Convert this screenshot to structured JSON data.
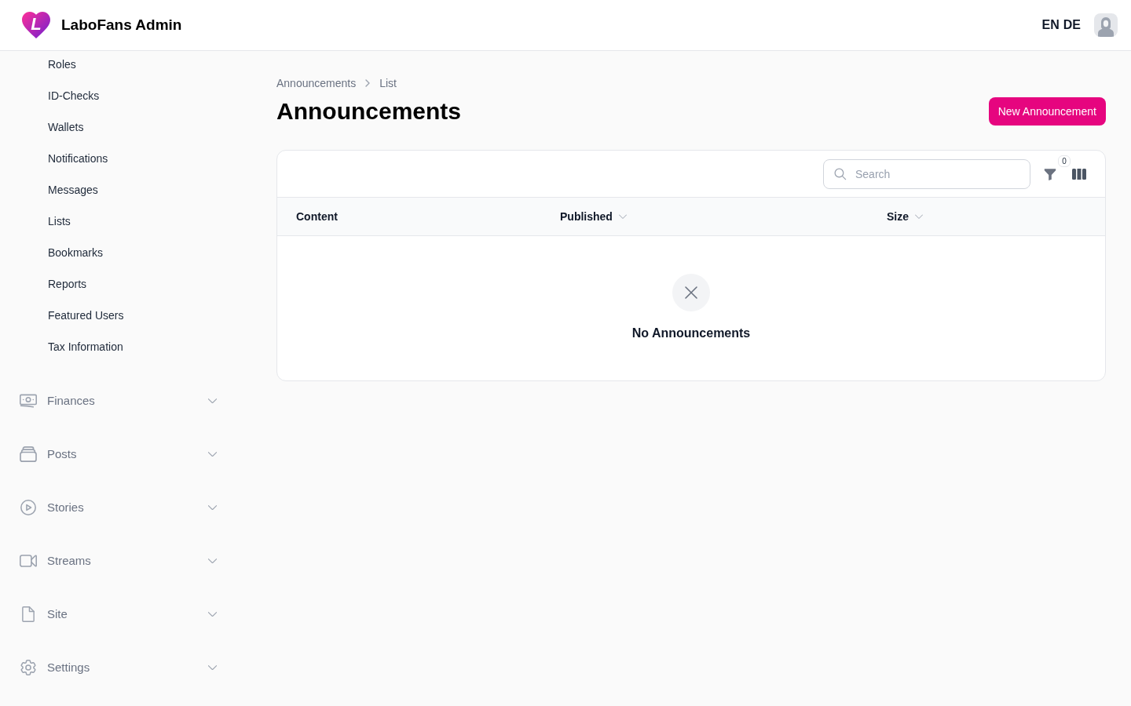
{
  "header": {
    "logo_letter": "L",
    "title": "LaboFans Admin",
    "languages": [
      {
        "label": "EN"
      },
      {
        "label": "DE"
      }
    ]
  },
  "sidebar": {
    "items": [
      {
        "label": "Roles"
      },
      {
        "label": "ID-Checks"
      },
      {
        "label": "Wallets"
      },
      {
        "label": "Notifications"
      },
      {
        "label": "Messages"
      },
      {
        "label": "Lists"
      },
      {
        "label": "Bookmarks"
      },
      {
        "label": "Reports"
      },
      {
        "label": "Featured Users"
      },
      {
        "label": "Tax Information"
      }
    ],
    "groups": [
      {
        "label": "Finances",
        "expanded": false
      },
      {
        "label": "Posts",
        "expanded": false
      },
      {
        "label": "Stories",
        "expanded": false
      },
      {
        "label": "Streams",
        "expanded": false
      },
      {
        "label": "Site",
        "expanded": false
      },
      {
        "label": "Settings",
        "expanded": false
      }
    ]
  },
  "breadcrumb": [
    {
      "label": "Announcements"
    },
    {
      "label": "List"
    }
  ],
  "page": {
    "title": "Announcements",
    "action": "New Announcement"
  },
  "table": {
    "search": {
      "placeholder": "Search"
    },
    "filter_count": "0",
    "columns": [
      {
        "label": "Content",
        "sortable": false
      },
      {
        "label": "Published",
        "sortable": true
      },
      {
        "label": "Size",
        "sortable": true
      }
    ],
    "empty": {
      "message": "No Announcements"
    }
  }
}
